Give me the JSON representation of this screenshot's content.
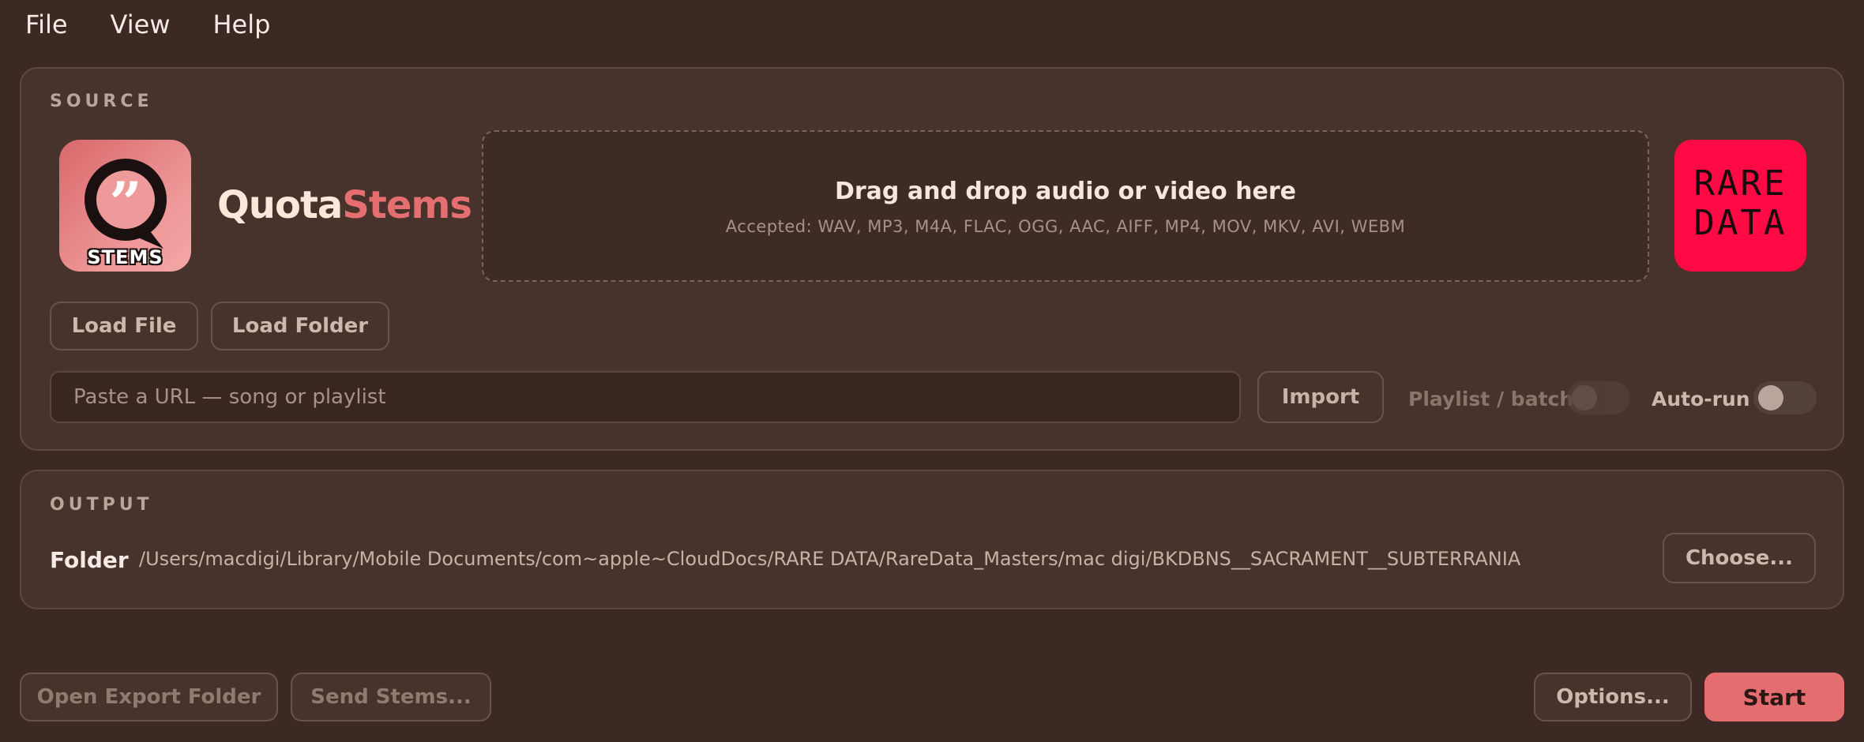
{
  "menu": {
    "items": [
      "File",
      "View",
      "Help"
    ]
  },
  "source": {
    "section_label": "SOURCE",
    "app_icon_caption": "STEMS",
    "app_name_part1": "Quota",
    "app_name_part2": "Stems",
    "dropzone": {
      "title": "Drag and drop audio or video here",
      "accepted": "Accepted: WAV, MP3, M4A, FLAC, OGG, AAC, AIFF, MP4, MOV, MKV, AVI, WEBM"
    },
    "brand_logo_line1": "RARE",
    "brand_logo_line2": "DATA",
    "load_file_label": "Load File",
    "load_folder_label": "Load Folder",
    "url_placeholder": "Paste a URL — song or playlist",
    "url_value": "",
    "import_label": "Import",
    "playlist_batch_label": "Playlist / batch",
    "playlist_batch_on": false,
    "auto_run_label": "Auto-run",
    "auto_run_on": false
  },
  "output": {
    "section_label": "OUTPUT",
    "folder_label": "Folder",
    "folder_path": "/Users/macdigi/Library/Mobile Documents/com~apple~CloudDocs/RARE DATA/RareData_Masters/mac digi/BKDBNS__SACRAMENT__SUBTERRANIA",
    "choose_label": "Choose..."
  },
  "footer": {
    "open_export_label": "Open Export Folder",
    "send_stems_label": "Send Stems...",
    "options_label": "Options...",
    "start_label": "Start"
  },
  "colors": {
    "background": "#3d2924",
    "panel": "#47322c",
    "accent": "#e46e6f",
    "brand_red": "#ff0a44"
  }
}
